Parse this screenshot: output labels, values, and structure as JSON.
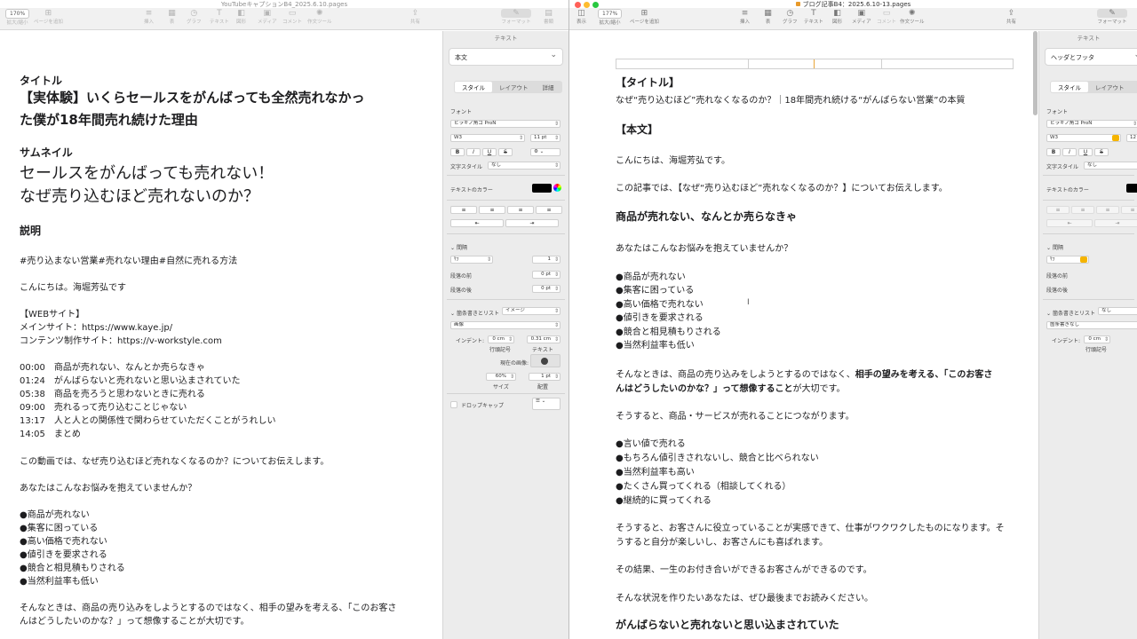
{
  "left": {
    "title": "YouTubeキャプションB4_2025.6.10.pages",
    "toolbar": {
      "zoom": "170%",
      "items": [
        {
          "label": "拡大/縮小",
          "icon": "zoom-icon"
        },
        {
          "label": "ページを追加",
          "icon": "add-page-icon"
        },
        {
          "label": "挿入",
          "icon": "insert-icon"
        },
        {
          "label": "表",
          "icon": "table-icon"
        },
        {
          "label": "グラフ",
          "icon": "chart-icon"
        },
        {
          "label": "テキスト",
          "icon": "text-icon"
        },
        {
          "label": "図形",
          "icon": "shape-icon"
        },
        {
          "label": "メディア",
          "icon": "media-icon"
        },
        {
          "label": "コメント",
          "icon": "comment-icon"
        },
        {
          "label": "作文ツール",
          "icon": "writing-tools-icon"
        },
        {
          "label": "共有",
          "icon": "share-icon"
        },
        {
          "label": "フォーマット",
          "icon": "format-icon"
        },
        {
          "label": "書類",
          "icon": "document-icon"
        }
      ]
    },
    "doc": {
      "title_label": "タイトル",
      "title_line1": "【実体験】いくらセールスをがんばっても全然売れなかっ",
      "title_line2": "た僕が18年間売れ続けた理由",
      "thumb_label": "サムネイル",
      "thumb_line1": "セールスをがんばっても売れない！",
      "thumb_line2": "なぜ売り込むほど売れないのか？",
      "desc_label": "説明",
      "hashtags": "#売り込まない営業#売れない理由#自然に売れる方法",
      "greeting": "こんにちは。海堀芳弘です",
      "web_heading": "【WEBサイト】",
      "site_main": "メインサイト：https://www.kaye.jp/",
      "site_content": "コンテンツ制作サイト：https://v-workstyle.com",
      "chapters": [
        "00:00　商品が売れない、なんとか売らなきゃ",
        "01:24　がんばらないと売れないと思い込まされていた",
        "05:38　商品を売ろうと思わないときに売れる",
        "09:00　売れるって売り込むことじゃない",
        "13:17　人と人との関係性で関わらせていただくことがうれしい",
        "14:05　まとめ"
      ],
      "intro": "この動画では、なぜ売り込むほど売れなくなるのか？についてお伝えします。",
      "question": "あなたはこんなお悩みを抱えていませんか？",
      "bullets": [
        "●商品が売れない",
        "●集客に困っている",
        "●高い価格で売れない",
        "●値引きを要求される",
        "●競合と相見積もりされる",
        "●当然利益率も低い"
      ],
      "closing_line1": "そんなときは、商品の売り込みをしようとするのではなく、相手の望みを考える、「このお客さ",
      "closing_line2": "んはどうしたいのかな？」って想像することが大切です。"
    },
    "inspector": {
      "header": "テキスト",
      "para_style": "本文",
      "tabs": [
        "スタイル",
        "レイアウト",
        "詳細"
      ],
      "font_label": "フォント",
      "font_name": "ヒラギノ角ゴ ProN",
      "font_weight": "W3",
      "font_size": "11 pt",
      "style_buttons": [
        "B",
        "I",
        "U",
        "S"
      ],
      "char_style_label": "文字スタイル",
      "char_style_value": "なし",
      "text_color_label": "テキストのカラー",
      "text_color": "#000000",
      "spacing_label": "間隔",
      "spacing_type": "行",
      "spacing_value": "1",
      "before_para_label": "段落の前",
      "before_para_value": "0 pt",
      "after_para_label": "段落の後",
      "after_para_value": "0 pt",
      "list_label": "箇条書きとリスト",
      "list_value": "イメージ",
      "list_type": "画像",
      "indent_label": "インデント:",
      "indent_bullet": "0 cm",
      "indent_text": "0.31 cm",
      "bullet_caption": "行頭記号",
      "text_caption": "テキスト",
      "current_image_label": "現在の画像:",
      "size_value": "60%",
      "size_caption": "サイズ",
      "align_value": "1 pt",
      "align_caption": "配置",
      "dropcap_label": "ドロップキャップ"
    }
  },
  "right": {
    "title": "ブログ記事B4：2025.6.10-13.pages",
    "toolbar": {
      "zoom": "177%",
      "items": [
        {
          "label": "表示",
          "icon": "sidebar-icon"
        },
        {
          "label": "拡大/縮小",
          "icon": "zoom-icon"
        },
        {
          "label": "ページを追加",
          "icon": "add-page-icon"
        },
        {
          "label": "挿入",
          "icon": "insert-icon"
        },
        {
          "label": "表",
          "icon": "table-icon"
        },
        {
          "label": "グラフ",
          "icon": "chart-icon"
        },
        {
          "label": "テキスト",
          "icon": "text-icon"
        },
        {
          "label": "図形",
          "icon": "shape-icon"
        },
        {
          "label": "メディア",
          "icon": "media-icon"
        },
        {
          "label": "コメント",
          "icon": "comment-icon"
        },
        {
          "label": "作文ツール",
          "icon": "writing-tools-icon"
        },
        {
          "label": "共有",
          "icon": "share-icon"
        },
        {
          "label": "フォーマット",
          "icon": "format-icon"
        }
      ]
    },
    "doc": {
      "title_label": "【タイトル】",
      "title_text": "なぜ“売り込むほど”売れなくなるのか？｜18年間売れ続ける“がんばらない営業”の本質",
      "body_label": "【本文】",
      "greeting": "こんにちは、海堀芳弘です。",
      "intro": "この記事では、【なぜ“売り込むほど”売れなくなるのか？】についてお伝えします。",
      "h1": "商品が売れない、なんとか売らなきゃ",
      "question": "あなたはこんなお悩みを抱えていませんか？",
      "bullets1": [
        "●商品が売れない",
        "●集客に困っている",
        "●高い価格で売れない",
        "●値引きを要求される",
        "●競合と相見積もりされる",
        "●当然利益率も低い"
      ],
      "para1_a": "そんなときは、商品の売り込みをしようとするのではなく、",
      "para1_b": "相手の望みを考える、「このお客さ",
      "para1_c": "んはどうしたいのかな？」って想像すること",
      "para1_d": "が大切です。",
      "para2": "そうすると、商品・サービスが売れることにつながります。",
      "bullets2": [
        "●言い値で売れる",
        "●もちろん値引きされないし、競合と比べられない",
        "●当然利益率も高い",
        "●たくさん買ってくれる（相談してくれる）",
        "●継続的に買ってくれる"
      ],
      "para3_line1": "そうすると、お客さんに役立っていることが実感できて、仕事がワクワクしたものになります。そ",
      "para3_line2": "うすると自分が楽しいし、お客さんにも喜ばれます。",
      "para4": "その結果、一生のお付き合いができるお客さんができるのです。",
      "para5": "そんな状況を作りたいあなたは、ぜひ最後までお読みください。",
      "h2": "がんばらないと売れないと思い込まされていた"
    },
    "inspector": {
      "header": "テキスト",
      "para_style": "ヘッダとフッタ",
      "tabs": [
        "スタイル",
        "レイアウト",
        "詳"
      ],
      "font_label": "フォント",
      "font_name": "ヒラギノ角ゴ ProN",
      "font_weight": "W3",
      "font_size": "12",
      "style_buttons": [
        "B",
        "I",
        "U",
        "S"
      ],
      "char_style_label": "文字スタイル",
      "char_style_value": "なし",
      "text_color_label": "テキストのカラー",
      "spacing_label": "間隔",
      "spacing_type": "行",
      "before_para_label": "段落の前",
      "after_para_label": "段落の後",
      "list_label": "箇条書きとリスト",
      "list_value": "なし",
      "list_type": "箇条書きなし",
      "indent_label": "インデント:",
      "indent_bullet": "0 cm",
      "bullet_caption": "行頭記号"
    }
  }
}
